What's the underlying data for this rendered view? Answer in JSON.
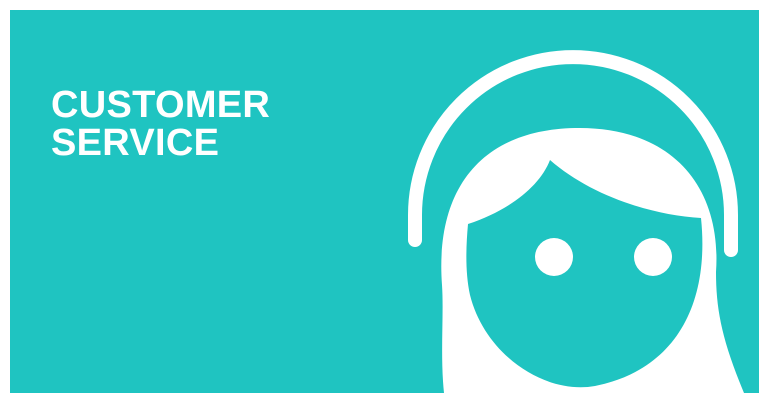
{
  "banner": {
    "background_color": "#1fc4c1",
    "foreground_color": "#ffffff",
    "title_line_1": "CUSTOMER",
    "title_line_2": "SERVICE",
    "illustration": "headset-agent-icon"
  }
}
